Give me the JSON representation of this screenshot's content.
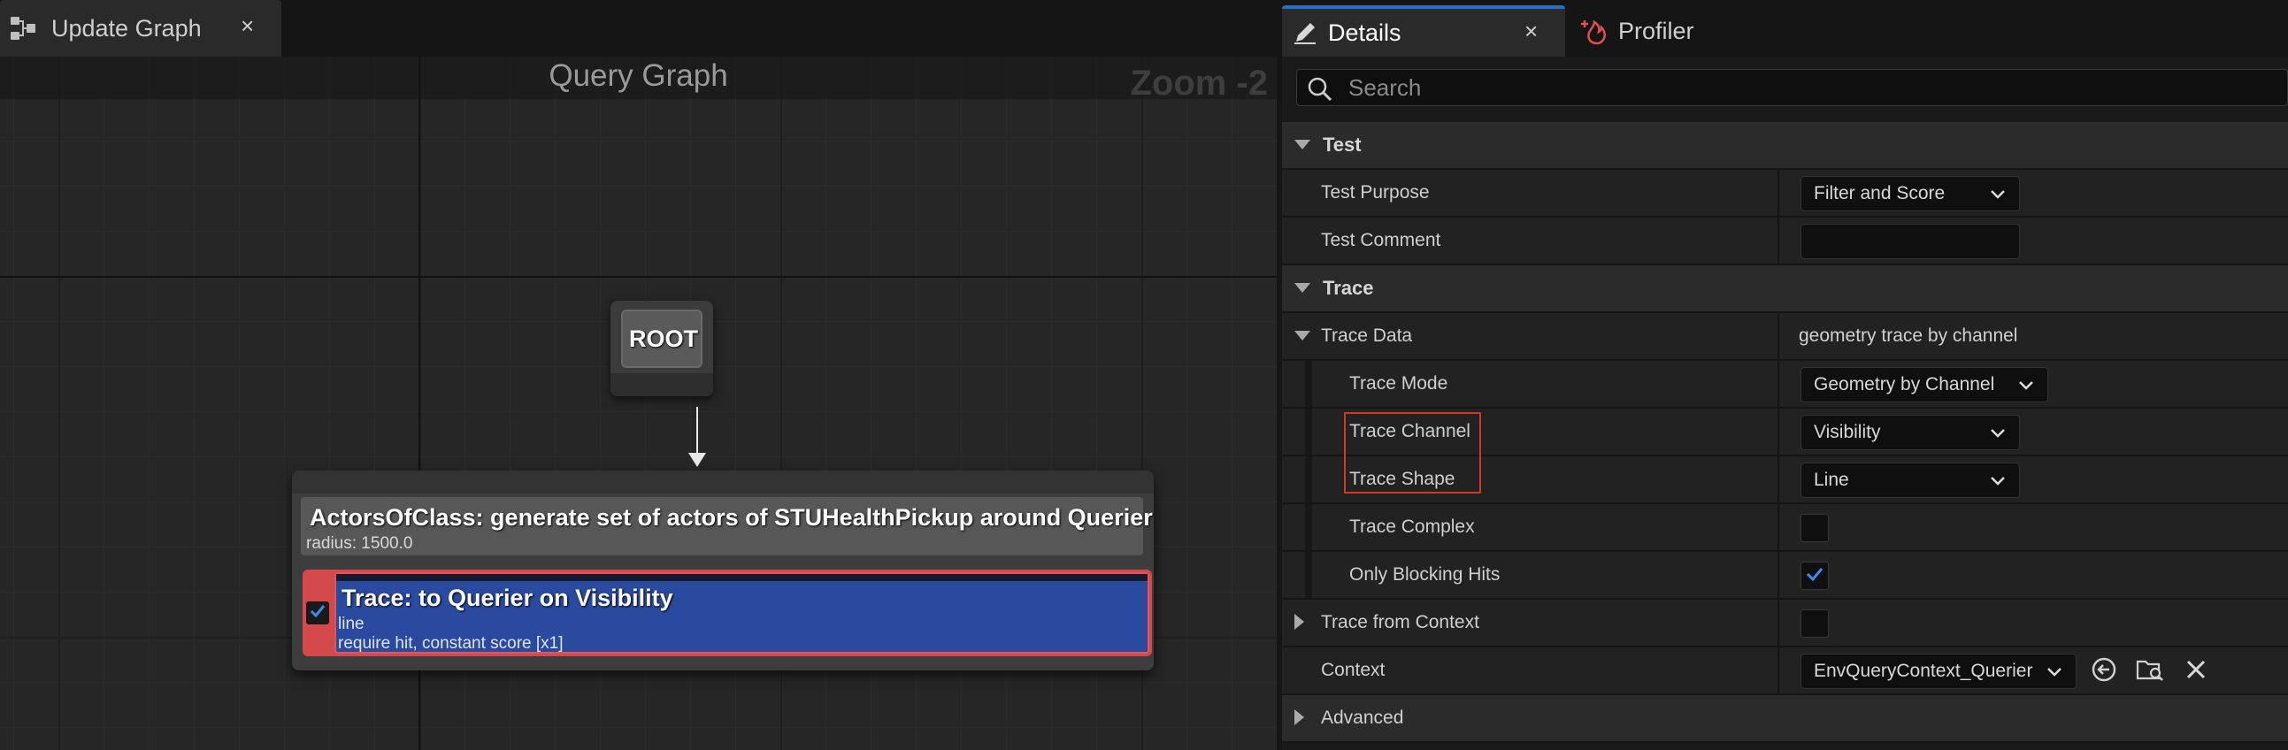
{
  "graph_editor": {
    "tab_label": "Update Graph",
    "tab_close": "×",
    "graph_title": "Query Graph",
    "zoom_label": "Zoom -2",
    "root_node": {
      "label": "ROOT"
    },
    "generator_node": {
      "title": "ActorsOfClass: generate set of actors of STUHealthPickup around Querier",
      "subtitle": "radius: 1500.0",
      "test": {
        "title": "Trace: to Querier on Visibility",
        "line1": "line",
        "line2": "require hit, constant score [x1]",
        "enabled": true
      }
    }
  },
  "details_panel": {
    "tabs": [
      {
        "label": "Details",
        "close": "×",
        "active": true
      },
      {
        "label": "Profiler",
        "active": false
      }
    ],
    "search": {
      "placeholder": "Search",
      "value": ""
    },
    "categories": {
      "test": {
        "label": "Test",
        "test_purpose": {
          "label": "Test Purpose",
          "value": "Filter and Score"
        },
        "test_comment": {
          "label": "Test Comment",
          "value": ""
        }
      },
      "trace": {
        "label": "Trace",
        "trace_data": {
          "label": "Trace Data",
          "value": "geometry trace by channel"
        },
        "trace_mode": {
          "label": "Trace Mode",
          "value": "Geometry by Channel"
        },
        "trace_channel": {
          "label": "Trace Channel",
          "value": "Visibility"
        },
        "trace_shape": {
          "label": "Trace Shape",
          "value": "Line"
        },
        "trace_complex": {
          "label": "Trace Complex",
          "checked": false
        },
        "only_blocking_hits": {
          "label": "Only Blocking Hits",
          "checked": true
        },
        "trace_from_context": {
          "label": "Trace from Context",
          "checked": false
        },
        "context": {
          "label": "Context",
          "value": "EnvQueryContext_Querier"
        }
      },
      "advanced": {
        "label": "Advanced"
      }
    }
  },
  "colors": {
    "accent_blue": "#2a6ec6",
    "test_node_blue": "#2a4aa0",
    "test_node_red": "#d44a4a",
    "highlight_red": "#d03a25",
    "check_blue": "#3b8af0"
  }
}
